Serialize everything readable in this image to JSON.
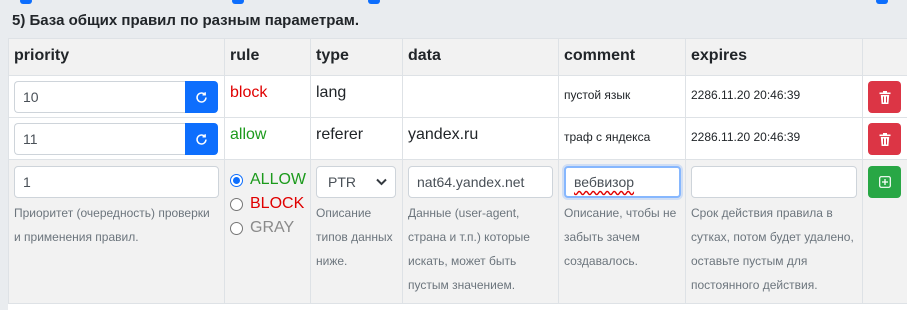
{
  "section": {
    "title": "5) База общих правил по разным параметрам."
  },
  "columns": {
    "priority": "priority",
    "rule": "rule",
    "type": "type",
    "data": "data",
    "comment": "comment",
    "expires": "expires"
  },
  "rows": [
    {
      "priority": "10",
      "rule": "block",
      "type": "lang",
      "data": "",
      "comment": "пустой язык",
      "expires": "2286.11.20 20:46:39"
    },
    {
      "priority": "11",
      "rule": "allow",
      "type": "referer",
      "data": "yandex.ru",
      "comment": "траф с яндекса",
      "expires": "2286.11.20 20:46:39"
    }
  ],
  "new_rule": {
    "priority_value": "1",
    "priority_help": "Приоритет (очередность) проверки и применения правил.",
    "rule_options": [
      "ALLOW",
      "BLOCK",
      "GRAY"
    ],
    "rule_selected": "ALLOW",
    "type_selected": "PTR",
    "type_help": "Описание типов данных ниже.",
    "data_value": "nat64.yandex.net",
    "data_help": "Данные (user-agent, страна и т.п.) которые искать, может быть пустым значением.",
    "comment_value": "вебвизор",
    "comment_help": "Описание, чтобы не забыть зачем создавалось.",
    "expires_value": "",
    "expires_help": "Срок действия правила в сутках, потом будет удалено, оставьте пустым для постоянного действия."
  },
  "colors": {
    "primary": "#0d6efd",
    "danger": "#dc3545",
    "success": "#28a745",
    "block_text": "#e00000",
    "allow_text": "#1c9a1c",
    "gray_text": "#8a8a8a"
  },
  "icons": {
    "refresh": "refresh-icon",
    "delete": "trash-icon",
    "add": "plus-square-icon",
    "select": "chevron-down-icon"
  }
}
